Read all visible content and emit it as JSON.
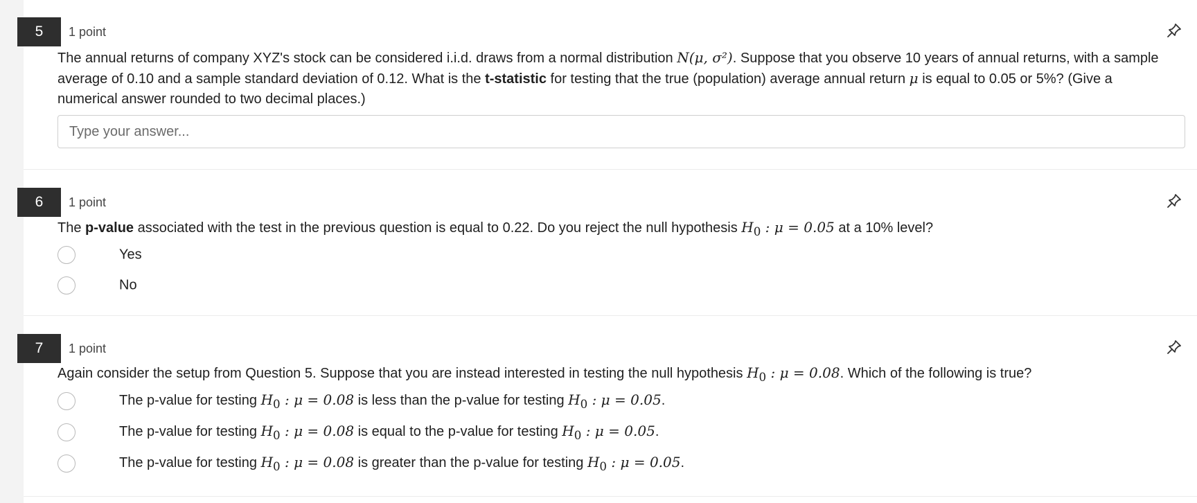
{
  "questions": [
    {
      "number": "5",
      "points": "1 point",
      "prompt_parts": [
        "The annual returns of company XYZ's stock can be considered i.i.d. draws from a normal distribution ",
        "N(μ, σ²)",
        ". Suppose that you observe 10 years of annual returns, with a sample average of 0.10 and a sample standard deviation of 0.12. What is the ",
        "t-statistic",
        " for testing that the true (population) average annual return ",
        "μ",
        " is equal to 0.05 or 5%? (Give a numerical answer rounded to two decimal places.)"
      ],
      "answer_placeholder": "Type your answer..."
    },
    {
      "number": "6",
      "points": "1 point",
      "prompt_parts": [
        "The ",
        "p-value",
        " associated with the test in the previous question is equal to 0.22. Do you reject the null hypothesis ",
        "H",
        "0",
        " : μ = 0.05",
        " at a 10% level?"
      ],
      "options": [
        "Yes",
        "No"
      ]
    },
    {
      "number": "7",
      "points": "1 point",
      "prompt_parts": [
        "Again consider the setup from Question 5. Suppose that you are instead interested in testing the null hypothesis ",
        "H",
        "0",
        " : μ = 0.08",
        ". Which of the following is true?"
      ],
      "options": [
        {
          "a": "The p-value for testing ",
          "h1": "H",
          "s1": "0",
          "e1": " : μ = 0.08",
          "b": " is less than the p-value for testing ",
          "h2": "H",
          "s2": "0",
          "e2": " : μ = 0.05",
          "c": "."
        },
        {
          "a": "The p-value for testing ",
          "h1": "H",
          "s1": "0",
          "e1": " : μ = 0.08",
          "b": " is equal to the p-value for testing ",
          "h2": "H",
          "s2": "0",
          "e2": " : μ = 0.05",
          "c": "."
        },
        {
          "a": "The p-value for testing ",
          "h1": "H",
          "s1": "0",
          "e1": " : μ = 0.08",
          "b": " is greater than the p-value for testing ",
          "h2": "H",
          "s2": "0",
          "e2": " : μ = 0.05",
          "c": "."
        }
      ]
    }
  ],
  "icons": {
    "pin": "pin-icon"
  },
  "colors": {
    "number_badge": "#2e2e2e",
    "background": "#f3f3f3",
    "radio_border": "#b8b8b8"
  }
}
